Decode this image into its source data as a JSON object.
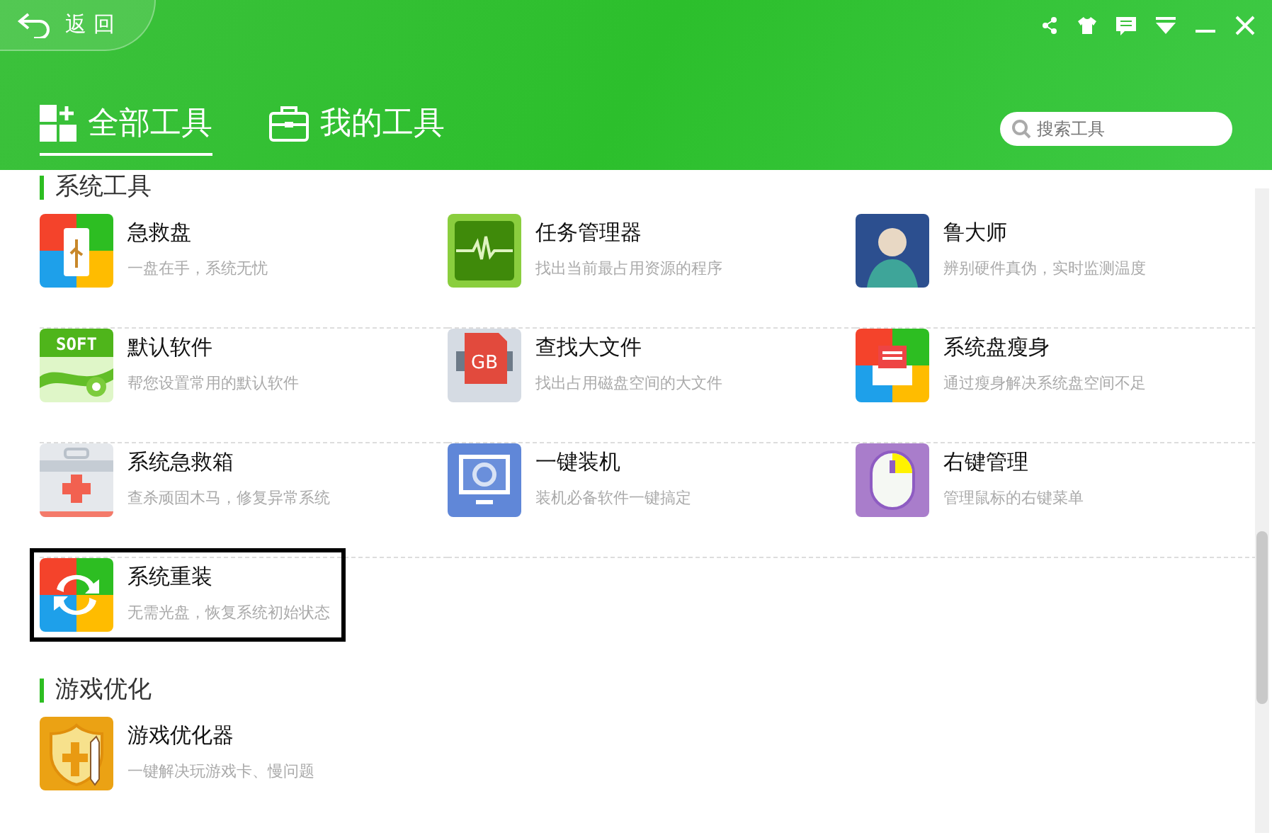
{
  "header": {
    "back": "返 回",
    "tabs": [
      {
        "label": "全部工具",
        "kind": "grid",
        "selected": true
      },
      {
        "label": "我的工具",
        "kind": "briefcase",
        "selected": false
      }
    ],
    "search": {
      "placeholder": "搜索工具"
    }
  },
  "sections": [
    {
      "title": "系统工具",
      "items": [
        {
          "name": "急救盘",
          "desc": "一盘在手，系统无忧",
          "kind": "usb",
          "selected": false
        },
        {
          "name": "任务管理器",
          "desc": "找出当前最占用资源的程序",
          "kind": "pulse",
          "selected": false
        },
        {
          "name": "鲁大师",
          "desc": "辨别硬件真伪，实时监测温度",
          "kind": "person",
          "selected": false
        },
        {
          "name": "默认软件",
          "desc": "帮您设置常用的默认软件",
          "kind": "soft",
          "icon_text": "SOFT",
          "selected": false
        },
        {
          "name": "查找大文件",
          "desc": "找出占用磁盘空间的大文件",
          "kind": "gb",
          "icon_text": "GB",
          "selected": false
        },
        {
          "name": "系统盘瘦身",
          "desc": "通过瘦身解决系统盘空间不足",
          "kind": "tray",
          "selected": false
        },
        {
          "name": "系统急救箱",
          "desc": "查杀顽固木马，修复异常系统",
          "kind": "medkit",
          "selected": false
        },
        {
          "name": "一键装机",
          "desc": "装机必备软件一键搞定",
          "kind": "monitor",
          "selected": false
        },
        {
          "name": "右键管理",
          "desc": "管理鼠标的右键菜单",
          "kind": "mouse",
          "selected": false
        },
        {
          "name": "系统重装",
          "desc": "无需光盘，恢复系统初始状态",
          "kind": "refresh",
          "selected": true
        }
      ]
    },
    {
      "title": "游戏优化",
      "items": [
        {
          "name": "游戏优化器",
          "desc": "一键解决玩游戏卡、慢问题",
          "kind": "shield",
          "selected": false
        }
      ]
    }
  ]
}
